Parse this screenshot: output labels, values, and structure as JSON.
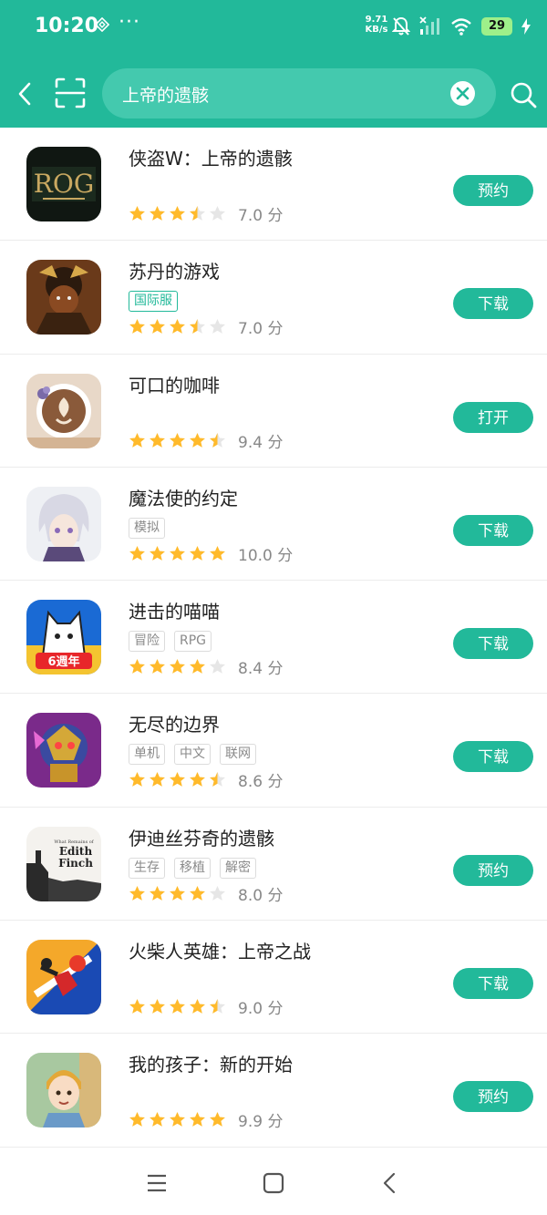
{
  "status_bar": {
    "time": "10:20",
    "dots": "···",
    "speed_value": "9.71",
    "speed_unit": "KB/s",
    "battery": "29"
  },
  "search": {
    "query": "上帝的遗骸"
  },
  "icons": {
    "back": "back-arrow-icon",
    "scan": "scan-icon",
    "clear": "clear-icon",
    "search": "search-icon"
  },
  "colors": {
    "brand": "#22b99a",
    "star": "#ffba2b",
    "star_empty": "#e6e6e6"
  },
  "apps": [
    {
      "name": "侠盗W：上帝的遗骸",
      "tags": [],
      "rating": 3.5,
      "score": "7.0 分",
      "action": "预约"
    },
    {
      "name": "苏丹的游戏",
      "tags": [
        "国际服"
      ],
      "rating": 3.5,
      "score": "7.0 分",
      "action": "下载"
    },
    {
      "name": "可口的咖啡",
      "tags": [],
      "rating": 4.5,
      "score": "9.4 分",
      "action": "打开"
    },
    {
      "name": "魔法使的约定",
      "tags": [
        "模拟"
      ],
      "rating": 5,
      "score": "10.0 分",
      "action": "下载"
    },
    {
      "name": "进击的喵喵",
      "tags": [
        "冒险",
        "RPG"
      ],
      "rating": 4,
      "score": "8.4 分",
      "action": "下载"
    },
    {
      "name": "无尽的边界",
      "tags": [
        "单机",
        "中文",
        "联网"
      ],
      "rating": 4.5,
      "score": "8.6 分",
      "action": "下载"
    },
    {
      "name": "伊迪丝芬奇的遗骸",
      "tags": [
        "生存",
        "移植",
        "解密"
      ],
      "rating": 4,
      "score": "8.0 分",
      "action": "预约"
    },
    {
      "name": "火柴人英雄：上帝之战",
      "tags": [],
      "rating": 4.5,
      "score": "9.0 分",
      "action": "下载"
    },
    {
      "name": "我的孩子：新的开始",
      "tags": [],
      "rating": 5,
      "score": "9.9 分",
      "action": "预约"
    }
  ],
  "icon_art": {
    "rog_text": "ROG",
    "edith_line1": "What Remains of",
    "edith_line2": "Edith",
    "edith_line3": "Finch",
    "cat_badge": "6週年"
  },
  "nav": {
    "menu": "menu-icon",
    "home": "home-icon",
    "back": "back-icon"
  }
}
